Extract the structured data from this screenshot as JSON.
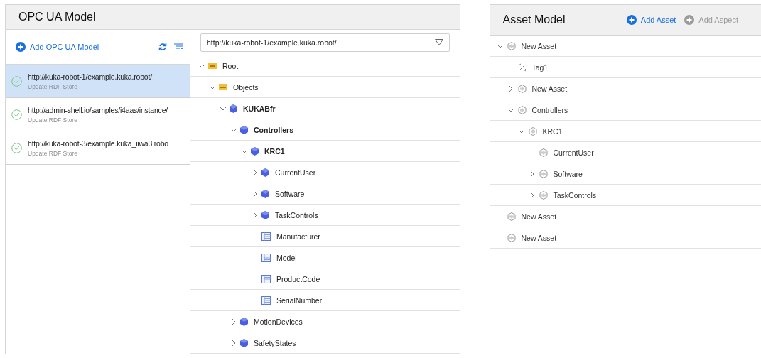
{
  "opc_panel": {
    "title": "OPC UA Model",
    "add_button": {
      "label": "Add OPC UA Model"
    },
    "models": [
      {
        "url": "http://kuka-robot-1/example.kuka.robot/",
        "status": "Update RDF Store",
        "selected": true
      },
      {
        "url": "http://admin-shell.io/samples/i4aas/instance/",
        "status": "Update RDF Store",
        "selected": false
      },
      {
        "url": "http://kuka-robot-3/example.kuka_iiwa3.robo",
        "status": "Update RDF Store",
        "selected": false
      }
    ],
    "model_select": {
      "value": "http://kuka-robot-1/example.kuka.robot/"
    },
    "tree": [
      {
        "label": "Root",
        "kind": "folder",
        "expanded": true,
        "children": [
          {
            "label": "Objects",
            "kind": "folder",
            "expanded": true,
            "children": [
              {
                "label": "KUKABfr",
                "kind": "object",
                "bold": true,
                "expanded": true,
                "children": [
                  {
                    "label": "Controllers",
                    "kind": "object",
                    "bold": true,
                    "expanded": true,
                    "children": [
                      {
                        "label": "KRC1",
                        "kind": "object",
                        "bold": true,
                        "expanded": true,
                        "children": [
                          {
                            "label": "CurrentUser",
                            "kind": "object",
                            "expanded": false
                          },
                          {
                            "label": "Software",
                            "kind": "object",
                            "expanded": false
                          },
                          {
                            "label": "TaskControls",
                            "kind": "object",
                            "expanded": false
                          },
                          {
                            "label": "Manufacturer",
                            "kind": "variable"
                          },
                          {
                            "label": "Model",
                            "kind": "variable"
                          },
                          {
                            "label": "ProductCode",
                            "kind": "variable"
                          },
                          {
                            "label": "SerialNumber",
                            "kind": "variable"
                          }
                        ]
                      }
                    ]
                  },
                  {
                    "label": "MotionDevices",
                    "kind": "object",
                    "expanded": false
                  },
                  {
                    "label": "SafetyStates",
                    "kind": "object",
                    "expanded": false
                  }
                ]
              }
            ]
          }
        ]
      }
    ]
  },
  "asset_panel": {
    "title": "Asset Model",
    "actions": [
      {
        "label": "Add Asset",
        "disabled": false
      },
      {
        "label": "Add Aspect",
        "disabled": true
      }
    ],
    "tree": [
      {
        "label": "New Asset",
        "kind": "asset",
        "expanded": true,
        "children": [
          {
            "label": "Tag1",
            "kind": "tag"
          },
          {
            "label": "New Asset",
            "kind": "asset",
            "expanded": false
          },
          {
            "label": "Controllers",
            "kind": "asset",
            "expanded": true,
            "children": [
              {
                "label": "KRC1",
                "kind": "asset",
                "expanded": true,
                "children": [
                  {
                    "label": "CurrentUser",
                    "kind": "asset"
                  },
                  {
                    "label": "Software",
                    "kind": "asset",
                    "expanded": false
                  },
                  {
                    "label": "TaskControls",
                    "kind": "asset",
                    "expanded": false
                  }
                ]
              }
            ]
          }
        ]
      },
      {
        "label": "New Asset",
        "kind": "asset"
      },
      {
        "label": "New Asset",
        "kind": "asset"
      }
    ]
  }
}
